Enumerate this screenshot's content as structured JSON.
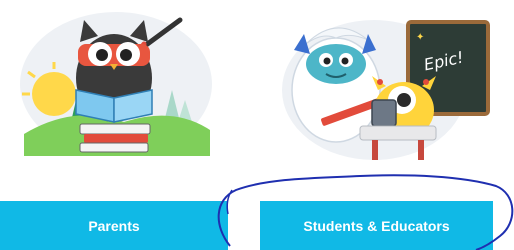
{
  "cards": {
    "parents": {
      "button_label": "Parents",
      "illustration_icon": "owl-reading-book-icon"
    },
    "students": {
      "button_label": "Students & Educators",
      "illustration_icon": "yeti-and-monster-classroom-icon",
      "chalkboard_text": "Epic!"
    }
  },
  "colors": {
    "button": "#10b9e6",
    "button_text": "#ffffff",
    "annotation": "#1f2fb0"
  }
}
